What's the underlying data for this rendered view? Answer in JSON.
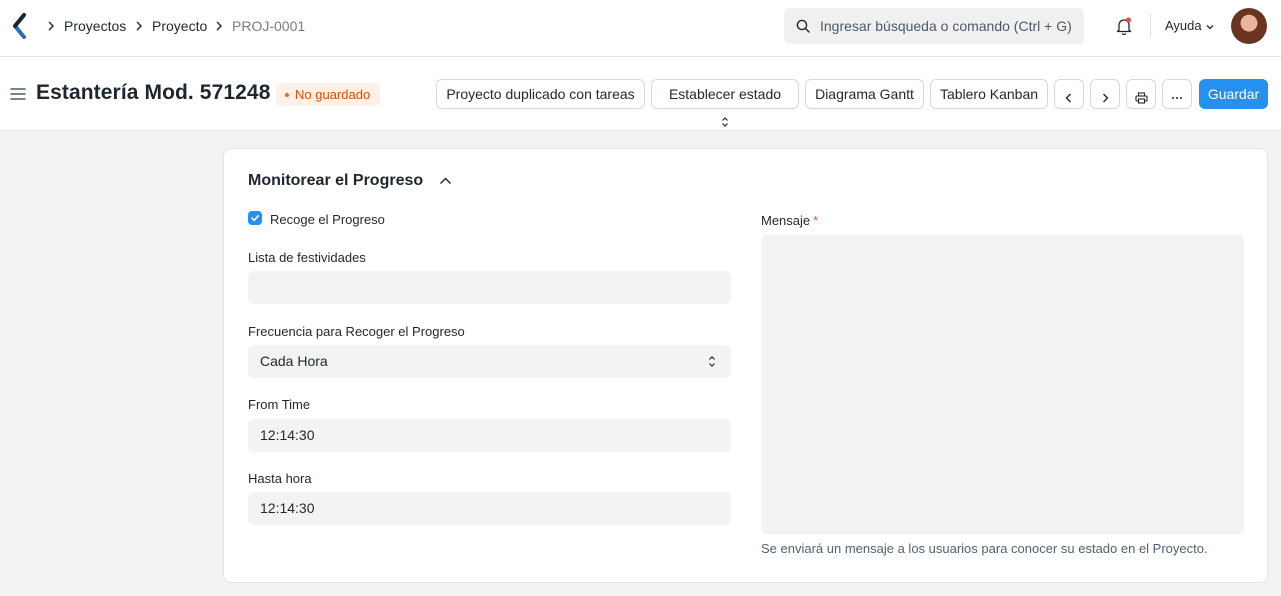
{
  "breadcrumbs": [
    "Proyectos",
    "Proyecto",
    "PROJ-0001"
  ],
  "search": {
    "placeholder": "Ingresar búsqueda o comando (Ctrl + G)"
  },
  "header": {
    "help_label": "Ayuda"
  },
  "page": {
    "title": "Estantería Mod. 571248",
    "status": "No guardado",
    "status_color": "#e24c00"
  },
  "toolbar": {
    "duplicate_label": "Proyecto duplicado con tareas",
    "set_status_label": "Establecer estado",
    "gantt_label": "Diagrama Gantt",
    "kanban_label": "Tablero Kanban",
    "save_label": "Guardar",
    "icons": [
      "chevron-left-icon",
      "chevron-right-icon",
      "printer-icon",
      "more-icon"
    ]
  },
  "section": {
    "title": "Monitorear el Progreso",
    "collect_progress": {
      "label": "Recoge el Progreso",
      "checked": true
    },
    "holiday_list": {
      "label": "Lista de festividades",
      "value": ""
    },
    "frequency": {
      "label": "Frecuencia para Recoger el Progreso",
      "value": "Cada Hora"
    },
    "from_time": {
      "label": "From Time",
      "value": "12:14:30"
    },
    "to_time": {
      "label": "Hasta hora",
      "value": "12:14:30"
    },
    "message": {
      "label": "Mensaje",
      "required_mark": "*",
      "value": "",
      "help": "Se enviará un mensaje a los usuarios para conocer su estado en el Proyecto."
    }
  },
  "colors": {
    "primary": "#2490ef",
    "badge_bg": "#fff0e9"
  }
}
